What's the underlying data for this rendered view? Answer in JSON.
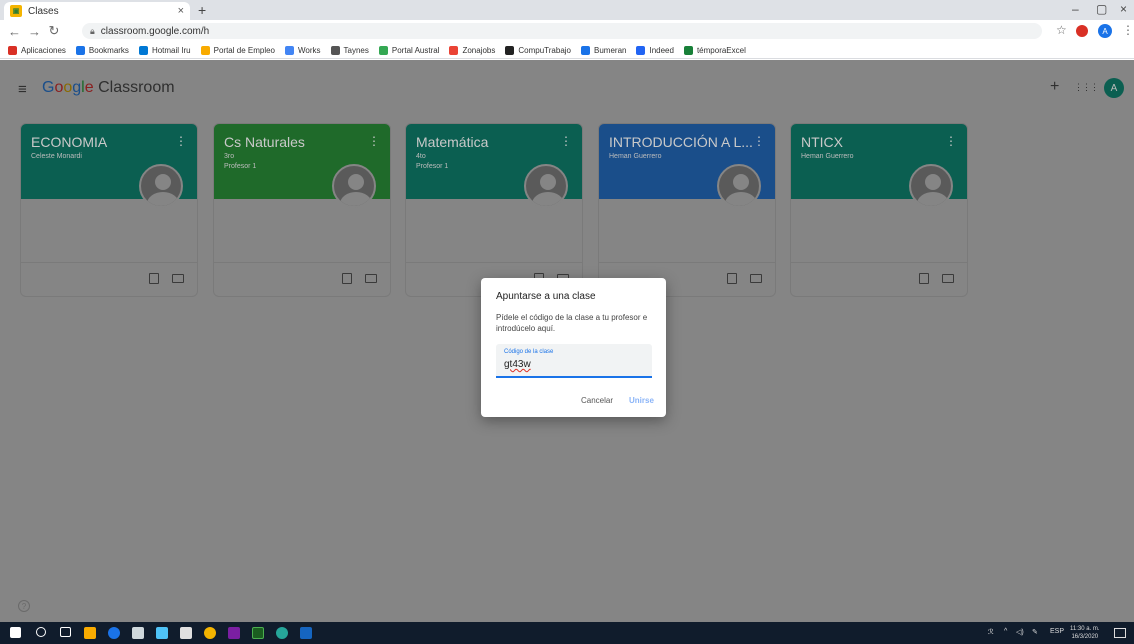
{
  "browser": {
    "tab_title": "Clases",
    "tab_close": "×",
    "new_tab": "+",
    "url": "classroom.google.com/h",
    "window_min": "–",
    "window_max": "▢",
    "window_close": "×",
    "profile_initial": "A",
    "bookmarks": [
      {
        "label": "Aplicaciones",
        "color": "#d93025"
      },
      {
        "label": "Bookmarks",
        "color": "#1a73e8"
      },
      {
        "label": "Hotmail Iru",
        "color": "#0078d4"
      },
      {
        "label": "Portal de Empleo",
        "color": "#f9ab00"
      },
      {
        "label": "Works",
        "color": "#4285f4"
      },
      {
        "label": "Taynes",
        "color": "#555555"
      },
      {
        "label": "Portal Austral",
        "color": "#34a853"
      },
      {
        "label": "Zonajobs",
        "color": "#ea4335"
      },
      {
        "label": "CompuTrabajo",
        "color": "#222222"
      },
      {
        "label": "Bumeran",
        "color": "#1a73e8"
      },
      {
        "label": "Indeed",
        "color": "#2164f3"
      },
      {
        "label": "témporaExcel",
        "color": "#188038"
      }
    ]
  },
  "app": {
    "menu_icon": "≡",
    "logo_google": [
      "G",
      "o",
      "o",
      "g",
      "l",
      "e"
    ],
    "logo_product": "Classroom",
    "add_icon": "+",
    "apps_icon": "⋮⋮⋮",
    "account_initial": "A"
  },
  "cards": [
    {
      "title": "ECONOMIA",
      "subtitle": "",
      "teacher": "Celeste Monardi",
      "color": "#0b5f51"
    },
    {
      "title": "Cs Naturales",
      "subtitle": "3ro",
      "teacher": "Profesor 1",
      "color": "#1f6a2a"
    },
    {
      "title": "Matemática",
      "subtitle": "4to",
      "teacher": "Profesor 1",
      "color": "#0b5f51"
    },
    {
      "title": "INTRODUCCIÓN A L...",
      "subtitle": "",
      "teacher": "Heman Guerrero",
      "color": "#1a4e8a"
    },
    {
      "title": "NTICX",
      "subtitle": "",
      "teacher": "Heman Guerrero",
      "color": "#0b5f51"
    }
  ],
  "dialog": {
    "title": "Apuntarse a una clase",
    "body": "Pídele el código de la clase a tu profesor e introdúcelo aquí.",
    "field_label": "Código de la clase",
    "field_value": "gt43w",
    "cancel": "Cancelar",
    "join": "Unirse"
  },
  "help_icon": "?",
  "taskbar": {
    "lang": "ESP",
    "time": "11:30 a. m.",
    "date": "16/3/2020"
  }
}
